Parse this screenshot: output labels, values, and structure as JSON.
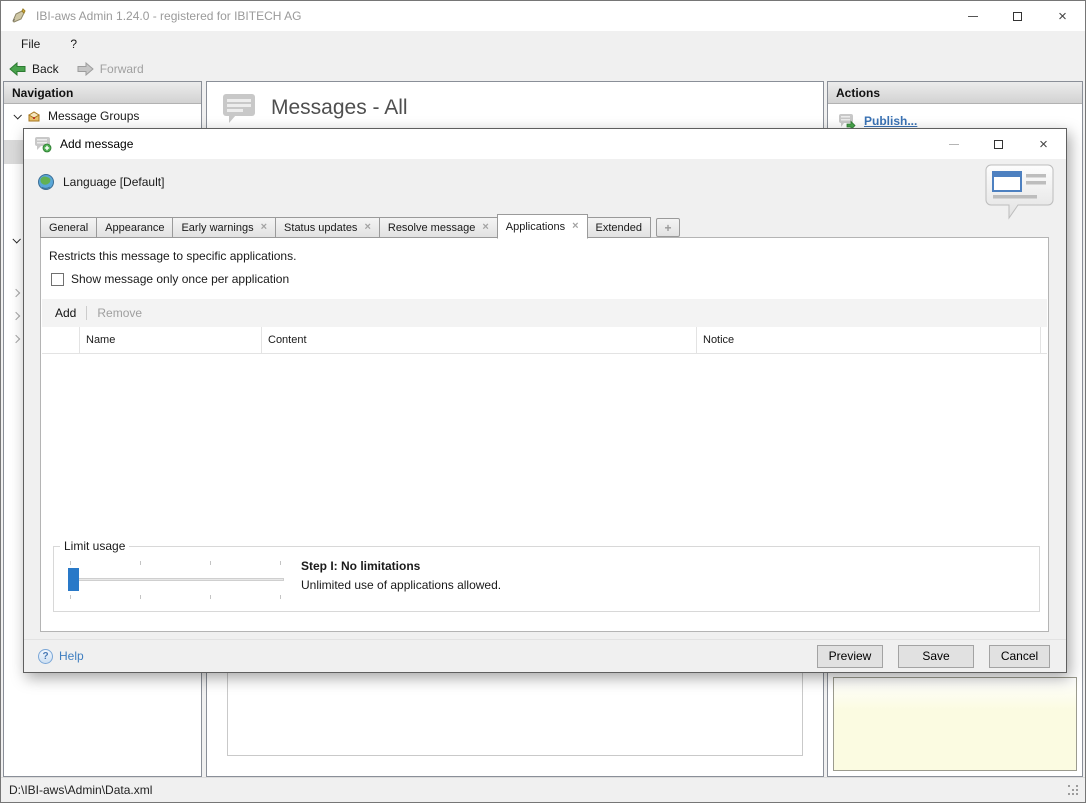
{
  "app": {
    "title": "IBI-aws Admin 1.24.0 - registered for IBITECH AG",
    "menu": {
      "items": [
        "File",
        "?"
      ]
    },
    "toolbar": {
      "back": "Back",
      "forward": "Forward"
    },
    "navigation": {
      "header": "Navigation",
      "root_item": "Message Groups"
    },
    "content": {
      "title": "Messages - All"
    },
    "actions": {
      "header": "Actions",
      "publish": "Publish..."
    },
    "status_bar": {
      "path": "D:\\IBI-aws\\Admin\\Data.xml"
    }
  },
  "dialog": {
    "title": "Add message",
    "language": "Language [Default]",
    "tabs": [
      {
        "label": "General",
        "closable": false
      },
      {
        "label": "Appearance",
        "closable": false
      },
      {
        "label": "Early warnings",
        "closable": true
      },
      {
        "label": "Status updates",
        "closable": true
      },
      {
        "label": "Resolve message",
        "closable": true
      },
      {
        "label": "Applications",
        "closable": true,
        "active": true
      },
      {
        "label": "Extended",
        "closable": false
      }
    ],
    "active_tab": "Applications",
    "applications_tab": {
      "description": "Restricts this message to specific applications.",
      "once_checkbox_label": "Show message only once per application",
      "once_checkbox_checked": false,
      "toolbar": {
        "add": "Add",
        "remove": "Remove",
        "remove_enabled": false
      },
      "table": {
        "columns": [
          "Name",
          "Content",
          "Notice"
        ],
        "rows": []
      },
      "limit_usage": {
        "legend": "Limit usage",
        "slider_position": 0,
        "tick_count": 4,
        "step_title": "Step I: No limitations",
        "step_description": "Unlimited use of applications allowed."
      }
    },
    "footer": {
      "help": "Help",
      "preview": "Preview",
      "save": "Save",
      "cancel": "Cancel"
    }
  },
  "icons": {
    "window_close": "×",
    "tab_close": "×",
    "add_tab": "+",
    "help_glyph": "?"
  },
  "colors": {
    "slider_thumb_blue": "#2979c8",
    "link_blue": "#3a72b4",
    "note_yellow": "#fbfbe1"
  }
}
